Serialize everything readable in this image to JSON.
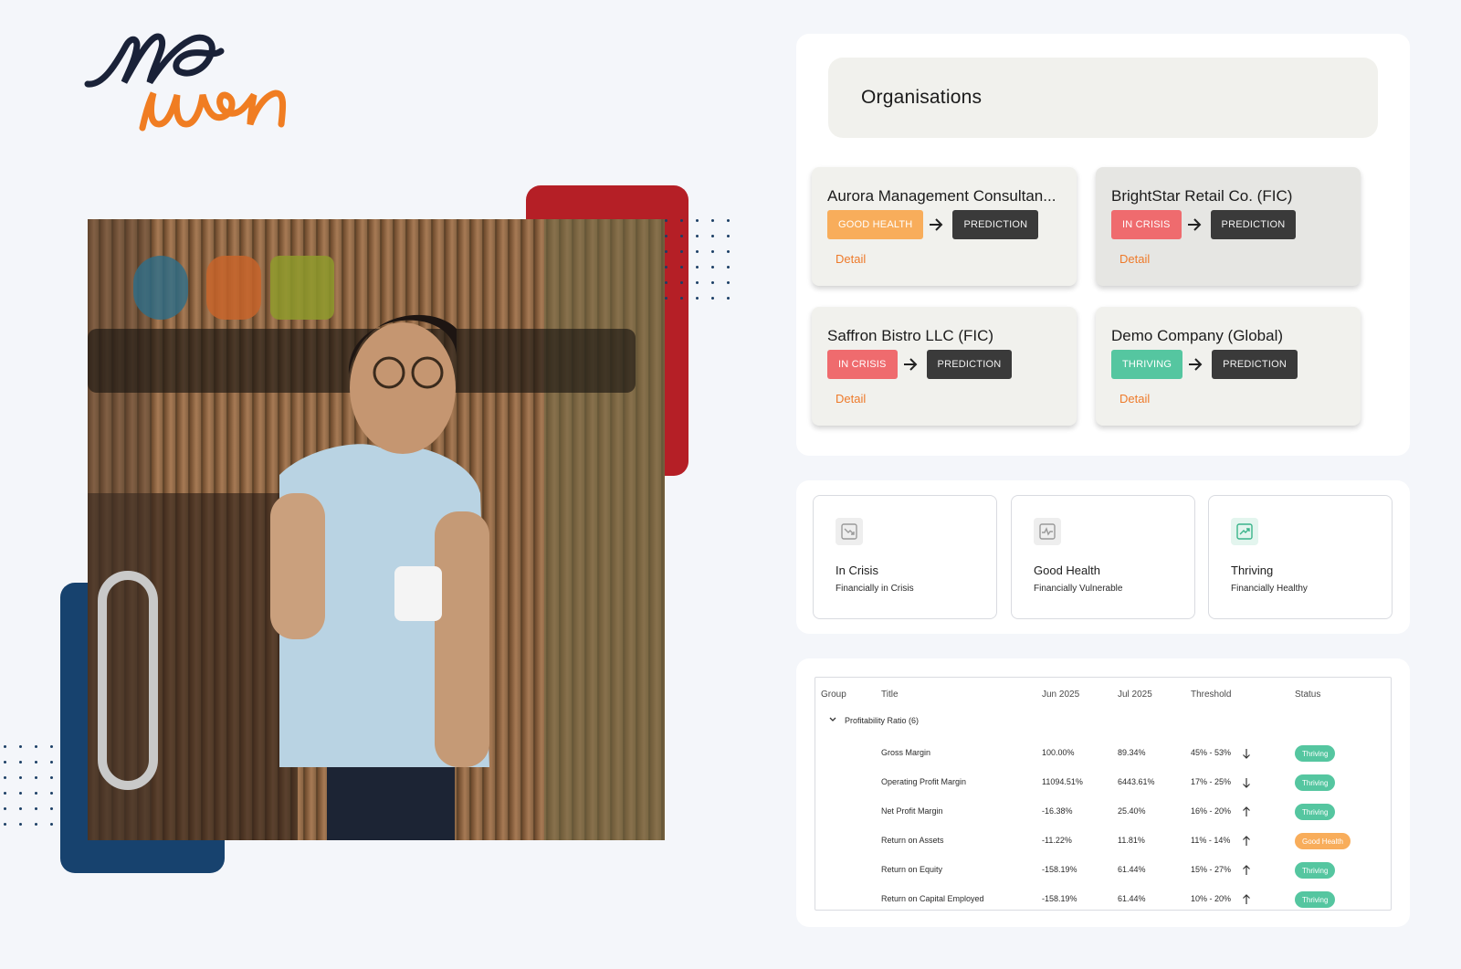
{
  "brand": {
    "accent": "#ee7a2a",
    "dark": "#1a2238",
    "red": "#b51f26",
    "blue": "#17426e"
  },
  "organisations": {
    "title": "Organisations",
    "cards": [
      {
        "name": "Aurora Management Consultan...",
        "status": "GOOD HEALTH",
        "status_kind": "good",
        "prediction": "PREDICTION",
        "detail": "Detail"
      },
      {
        "name": "BrightStar Retail Co. (FIC)",
        "status": "IN CRISIS",
        "status_kind": "crisis",
        "prediction": "PREDICTION",
        "detail": "Detail"
      },
      {
        "name": "Saffron Bistro LLC (FIC)",
        "status": "IN CRISIS",
        "status_kind": "crisis",
        "prediction": "PREDICTION",
        "detail": "Detail"
      },
      {
        "name": "Demo Company (Global)",
        "status": "THRIVING",
        "status_kind": "thriving",
        "prediction": "PREDICTION",
        "detail": "Detail"
      }
    ]
  },
  "summary": [
    {
      "title": "In Crisis",
      "subtitle": "Financially in Crisis",
      "icon": "trend-down-icon"
    },
    {
      "title": "Good Health",
      "subtitle": "Financially Vulnerable",
      "icon": "pulse-icon"
    },
    {
      "title": "Thriving",
      "subtitle": "Financially Healthy",
      "icon": "trend-up-icon"
    }
  ],
  "table": {
    "headers": {
      "group": "Group",
      "title": "Title",
      "jun": "Jun 2025",
      "jul": "Jul 2025",
      "threshold": "Threshold",
      "status": "Status"
    },
    "group_label": "Profitability Ratio (6)",
    "rows": [
      {
        "title": "Gross Margin",
        "jun": "100.00%",
        "jul": "89.34%",
        "threshold": "45% - 53%",
        "direction": "down",
        "status": "Thriving",
        "status_kind": "thriving"
      },
      {
        "title": "Operating Profit Margin",
        "jun": "11094.51%",
        "jul": "6443.61%",
        "threshold": "17% - 25%",
        "direction": "down",
        "status": "Thriving",
        "status_kind": "thriving"
      },
      {
        "title": "Net Profit Margin",
        "jun": "-16.38%",
        "jul": "25.40%",
        "threshold": "16% - 20%",
        "direction": "up",
        "status": "Thriving",
        "status_kind": "thriving"
      },
      {
        "title": "Return on Assets",
        "jun": "-11.22%",
        "jul": "11.81%",
        "threshold": "11% - 14%",
        "direction": "up",
        "status": "Good Health",
        "status_kind": "good"
      },
      {
        "title": "Return on Equity",
        "jun": "-158.19%",
        "jul": "61.44%",
        "threshold": "15% - 27%",
        "direction": "up",
        "status": "Thriving",
        "status_kind": "thriving"
      },
      {
        "title": "Return on Capital Employed",
        "jun": "-158.19%",
        "jul": "61.44%",
        "threshold": "10% - 20%",
        "direction": "up",
        "status": "Thriving",
        "status_kind": "thriving"
      }
    ]
  }
}
